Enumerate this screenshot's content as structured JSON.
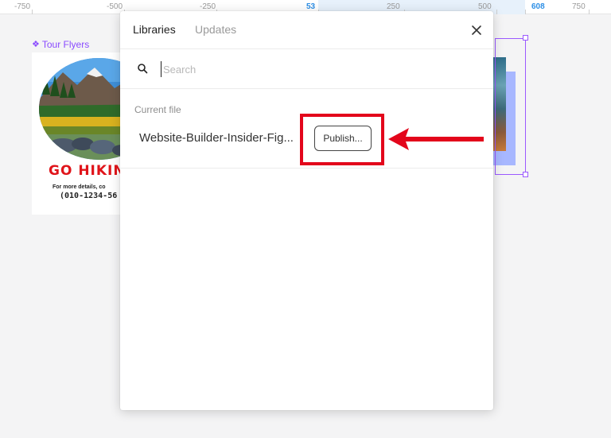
{
  "ruler": {
    "ticks": [
      "-750",
      "-500",
      "-250",
      "53",
      "250",
      "500",
      "608",
      "750"
    ]
  },
  "canvas": {
    "frame_label": "Tour Flyers",
    "flyer": {
      "heading": "GO HIKIN",
      "details": "For more details, co",
      "phone": "(010-1234-56"
    }
  },
  "modal": {
    "tabs": [
      {
        "label": "Libraries",
        "active": true
      },
      {
        "label": "Updates",
        "active": false
      }
    ],
    "close_icon": "close-icon",
    "search": {
      "placeholder": "Search",
      "value": "",
      "icon": "search-icon"
    },
    "section_label": "Current file",
    "file": {
      "name": "Website-Builder-Insider-Fig...",
      "publish_label": "Publish..."
    }
  },
  "colors": {
    "accent_purple": "#8a4bff",
    "annotation_red": "#e3061b",
    "ruler_highlight": "#2d8fe6",
    "flyer_heading": "#e0141a"
  }
}
